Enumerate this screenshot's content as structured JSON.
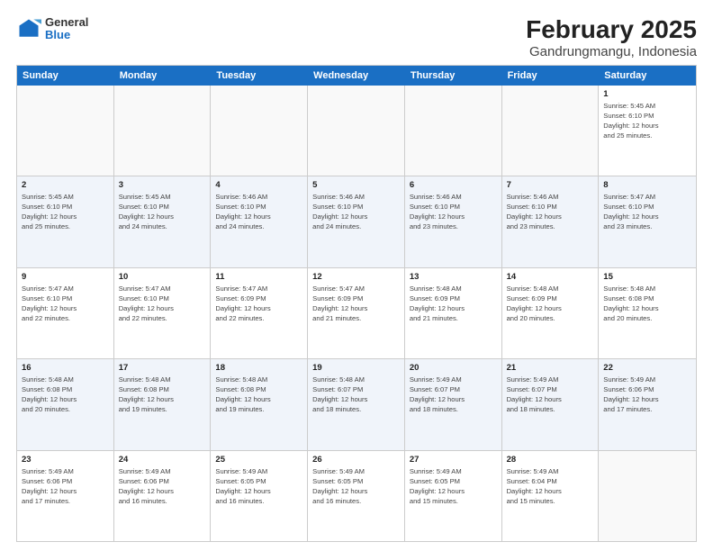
{
  "logo": {
    "general": "General",
    "blue": "Blue"
  },
  "title": "February 2025",
  "subtitle": "Gandrungmangu, Indonesia",
  "weekdays": [
    "Sunday",
    "Monday",
    "Tuesday",
    "Wednesday",
    "Thursday",
    "Friday",
    "Saturday"
  ],
  "rows": [
    {
      "cells": [
        {
          "empty": true
        },
        {
          "empty": true
        },
        {
          "empty": true
        },
        {
          "empty": true
        },
        {
          "empty": true
        },
        {
          "empty": true
        },
        {
          "day": "1",
          "info": "Sunrise: 5:45 AM\nSunset: 6:10 PM\nDaylight: 12 hours\nand 25 minutes."
        }
      ]
    },
    {
      "cells": [
        {
          "day": "2",
          "info": "Sunrise: 5:45 AM\nSunset: 6:10 PM\nDaylight: 12 hours\nand 25 minutes."
        },
        {
          "day": "3",
          "info": "Sunrise: 5:45 AM\nSunset: 6:10 PM\nDaylight: 12 hours\nand 24 minutes."
        },
        {
          "day": "4",
          "info": "Sunrise: 5:46 AM\nSunset: 6:10 PM\nDaylight: 12 hours\nand 24 minutes."
        },
        {
          "day": "5",
          "info": "Sunrise: 5:46 AM\nSunset: 6:10 PM\nDaylight: 12 hours\nand 24 minutes."
        },
        {
          "day": "6",
          "info": "Sunrise: 5:46 AM\nSunset: 6:10 PM\nDaylight: 12 hours\nand 23 minutes."
        },
        {
          "day": "7",
          "info": "Sunrise: 5:46 AM\nSunset: 6:10 PM\nDaylight: 12 hours\nand 23 minutes."
        },
        {
          "day": "8",
          "info": "Sunrise: 5:47 AM\nSunset: 6:10 PM\nDaylight: 12 hours\nand 23 minutes."
        }
      ]
    },
    {
      "cells": [
        {
          "day": "9",
          "info": "Sunrise: 5:47 AM\nSunset: 6:10 PM\nDaylight: 12 hours\nand 22 minutes."
        },
        {
          "day": "10",
          "info": "Sunrise: 5:47 AM\nSunset: 6:10 PM\nDaylight: 12 hours\nand 22 minutes."
        },
        {
          "day": "11",
          "info": "Sunrise: 5:47 AM\nSunset: 6:09 PM\nDaylight: 12 hours\nand 22 minutes."
        },
        {
          "day": "12",
          "info": "Sunrise: 5:47 AM\nSunset: 6:09 PM\nDaylight: 12 hours\nand 21 minutes."
        },
        {
          "day": "13",
          "info": "Sunrise: 5:48 AM\nSunset: 6:09 PM\nDaylight: 12 hours\nand 21 minutes."
        },
        {
          "day": "14",
          "info": "Sunrise: 5:48 AM\nSunset: 6:09 PM\nDaylight: 12 hours\nand 20 minutes."
        },
        {
          "day": "15",
          "info": "Sunrise: 5:48 AM\nSunset: 6:08 PM\nDaylight: 12 hours\nand 20 minutes."
        }
      ]
    },
    {
      "cells": [
        {
          "day": "16",
          "info": "Sunrise: 5:48 AM\nSunset: 6:08 PM\nDaylight: 12 hours\nand 20 minutes."
        },
        {
          "day": "17",
          "info": "Sunrise: 5:48 AM\nSunset: 6:08 PM\nDaylight: 12 hours\nand 19 minutes."
        },
        {
          "day": "18",
          "info": "Sunrise: 5:48 AM\nSunset: 6:08 PM\nDaylight: 12 hours\nand 19 minutes."
        },
        {
          "day": "19",
          "info": "Sunrise: 5:48 AM\nSunset: 6:07 PM\nDaylight: 12 hours\nand 18 minutes."
        },
        {
          "day": "20",
          "info": "Sunrise: 5:49 AM\nSunset: 6:07 PM\nDaylight: 12 hours\nand 18 minutes."
        },
        {
          "day": "21",
          "info": "Sunrise: 5:49 AM\nSunset: 6:07 PM\nDaylight: 12 hours\nand 18 minutes."
        },
        {
          "day": "22",
          "info": "Sunrise: 5:49 AM\nSunset: 6:06 PM\nDaylight: 12 hours\nand 17 minutes."
        }
      ]
    },
    {
      "cells": [
        {
          "day": "23",
          "info": "Sunrise: 5:49 AM\nSunset: 6:06 PM\nDaylight: 12 hours\nand 17 minutes."
        },
        {
          "day": "24",
          "info": "Sunrise: 5:49 AM\nSunset: 6:06 PM\nDaylight: 12 hours\nand 16 minutes."
        },
        {
          "day": "25",
          "info": "Sunrise: 5:49 AM\nSunset: 6:05 PM\nDaylight: 12 hours\nand 16 minutes."
        },
        {
          "day": "26",
          "info": "Sunrise: 5:49 AM\nSunset: 6:05 PM\nDaylight: 12 hours\nand 16 minutes."
        },
        {
          "day": "27",
          "info": "Sunrise: 5:49 AM\nSunset: 6:05 PM\nDaylight: 12 hours\nand 15 minutes."
        },
        {
          "day": "28",
          "info": "Sunrise: 5:49 AM\nSunset: 6:04 PM\nDaylight: 12 hours\nand 15 minutes."
        },
        {
          "empty": true
        }
      ]
    }
  ]
}
